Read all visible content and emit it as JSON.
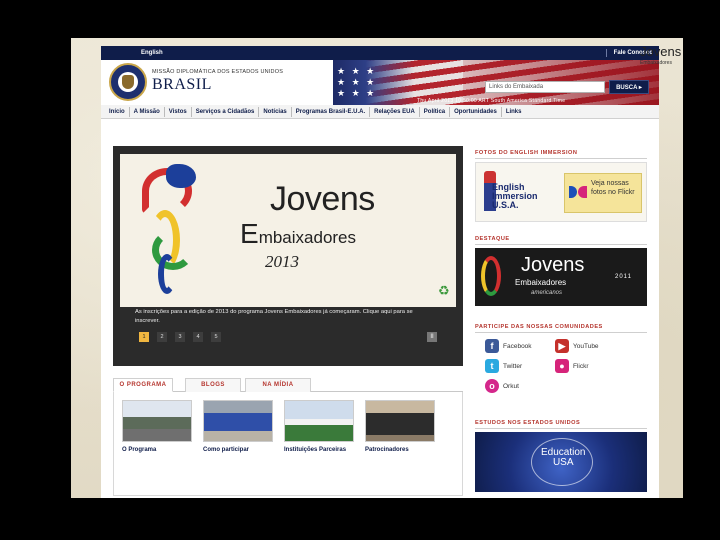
{
  "topbar": {
    "language": "English",
    "contact": "Fale Conosco"
  },
  "header": {
    "mission_line": "MISSÃO DIPLOMÁTICA DOS ESTADOS UNIDOS",
    "country": "BRASIL",
    "search_placeholder": "Links do Embaixada",
    "search_button": "BUSCA ▸",
    "dateline": "Thu April 2013 10:50:00 ART South America Standard Time"
  },
  "nav": {
    "items": [
      "Início",
      "A Missão",
      "Vistos",
      "Serviços a Cidadãos",
      "Notícias",
      "Programas Brasil-E.U.A.",
      "Relações EUA",
      "Política",
      "Oportunidades",
      "Links"
    ]
  },
  "slider": {
    "title": "Jovens",
    "subtitle_cap": "E",
    "subtitle_rest": "mbaixadores",
    "year": "2013",
    "caption": "As inscrições para a edição de 2013 do programa Jovens Embaixadores já começaram. Clique aqui para se inscrever.",
    "dots": [
      "1",
      "2",
      "3",
      "4",
      "5"
    ],
    "active_dot": 0,
    "pause": "II"
  },
  "tabs": {
    "items": [
      "O PROGRAMA",
      "BLOGS",
      "NA MÍDIA"
    ],
    "active": 0,
    "cards": [
      {
        "label": "O Programa"
      },
      {
        "label": "Como participar"
      },
      {
        "label": "Instituições Parceiras"
      },
      {
        "label": "Patrocinadores"
      }
    ]
  },
  "right": {
    "english": {
      "heading": "FOTOS DO ENGLISH IMMERSION",
      "banner_line1": "English",
      "banner_line2": "Immersion",
      "banner_line3": "U.S.A.",
      "flickr_text": "Veja nossas fotos no Flickr"
    },
    "destaque": {
      "heading": "DESTAQUE",
      "title": "Jovens",
      "subtitle": "Embaixadores",
      "year": "2011",
      "tagline": "americanos"
    },
    "social": {
      "heading": "PARTICIPE DAS NOSSAS COMUNIDADES",
      "items": [
        {
          "name": "Facebook",
          "glyph": "f",
          "color": "#3b5998"
        },
        {
          "name": "YouTube",
          "glyph": "▶",
          "color": "#c4302b"
        },
        {
          "name": "Twitter",
          "glyph": "t",
          "color": "#2aa9e0"
        },
        {
          "name": "Flickr",
          "glyph": "●",
          "color": "#d6247a"
        },
        {
          "name": "Orkut",
          "glyph": "o",
          "color": "#d4278b"
        }
      ]
    },
    "estudos": {
      "heading": "ESTUDOS NOS ESTADOS UNIDOS",
      "banner_line1": "Education",
      "banner_line2": "USA"
    }
  },
  "edge": {
    "logo": "Jovens",
    "sub": "Embaixadores"
  }
}
